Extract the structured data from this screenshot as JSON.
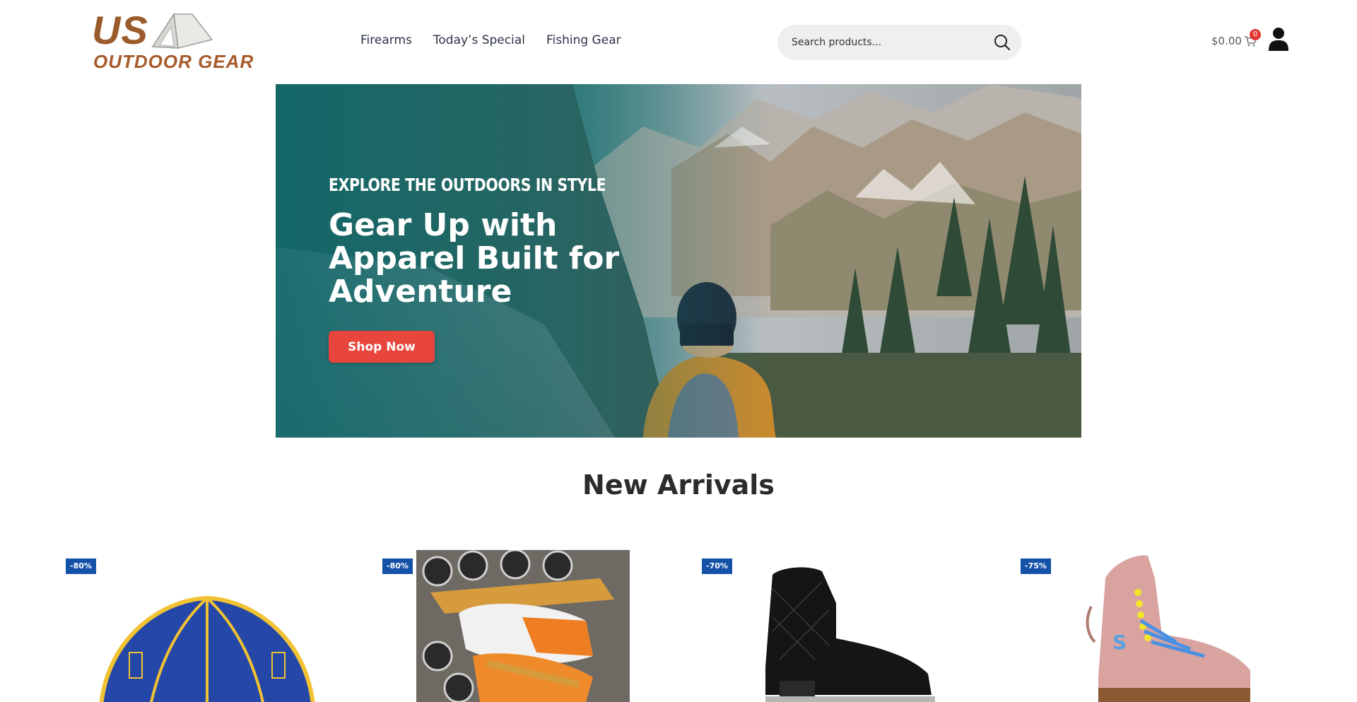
{
  "header": {
    "logo": {
      "line1": "US",
      "line2": "OUTDOOR GEAR"
    },
    "nav": [
      "Firearms",
      "Today’s Special",
      "Fishing Gear"
    ],
    "search": {
      "placeholder": "Search products..."
    },
    "cart": {
      "amount": "$0.00",
      "count": "0"
    }
  },
  "hero": {
    "eyebrow": "EXPLORE THE OUTDOORS IN STYLE",
    "title": "Gear Up with Apparel Built for Adventure",
    "cta": "Shop Now"
  },
  "new_arrivals": {
    "title": "New Arrivals",
    "products": [
      {
        "discount": "-80%"
      },
      {
        "discount": "-80%"
      },
      {
        "discount": "-70%"
      },
      {
        "discount": "-75%"
      }
    ]
  }
}
